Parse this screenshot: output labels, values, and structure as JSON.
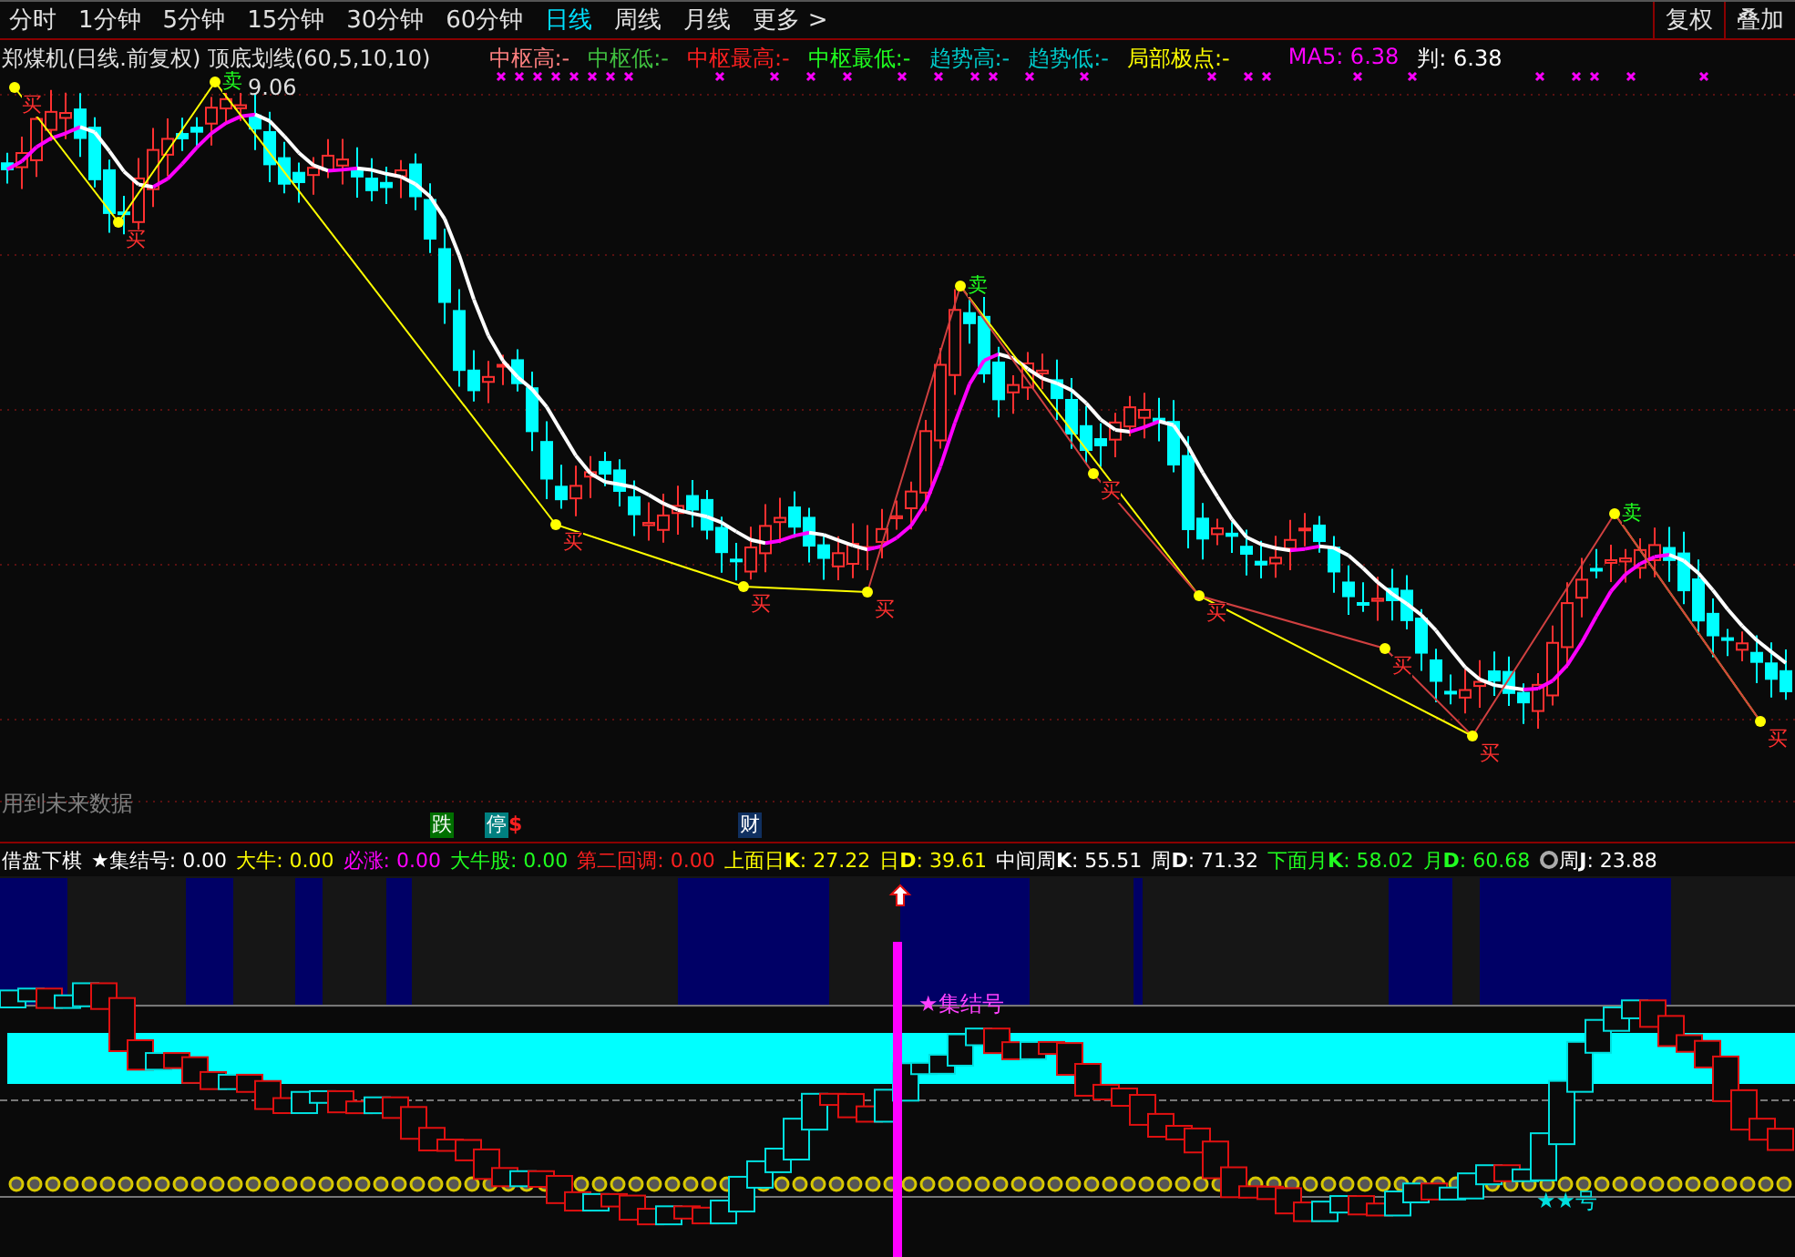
{
  "tabs": [
    {
      "label": "分时",
      "selected": false
    },
    {
      "label": "1分钟",
      "selected": false
    },
    {
      "label": "5分钟",
      "selected": false
    },
    {
      "label": "15分钟",
      "selected": false
    },
    {
      "label": "30分钟",
      "selected": false
    },
    {
      "label": "60分钟",
      "selected": false
    },
    {
      "label": "日线",
      "selected": true
    },
    {
      "label": "周线",
      "selected": false
    },
    {
      "label": "月线",
      "selected": false
    },
    {
      "label": "更多 >",
      "selected": false
    }
  ],
  "right_buttons": [
    "复权",
    "叠加"
  ],
  "main_chart": {
    "title": "郑煤机(日线.前复权) 顶底划线(60,5,10,10)",
    "legend": [
      {
        "label": "中枢高:-",
        "color": "#ff8080"
      },
      {
        "label": "中枢低:-",
        "color": "#40c040"
      },
      {
        "label": "中枢最高:-",
        "color": "#ff2020"
      },
      {
        "label": "中枢最低:-",
        "color": "#20ff20"
      },
      {
        "label": "趋势高:-",
        "color": "#00c8c8"
      },
      {
        "label": "趋势低:-",
        "color": "#00c8c8"
      },
      {
        "label": "局部极点:-",
        "color": "#ffff00"
      },
      {
        "label": "MA5: 6.38",
        "color": "#ff00ff"
      },
      {
        "label": "判: 6.38",
        "color": "#ffffff"
      }
    ],
    "high_price": "9.06",
    "signals": [
      {
        "text": "买",
        "kind": "low"
      },
      {
        "text": "买",
        "kind": "low"
      },
      {
        "text": "卖",
        "kind": "high"
      },
      {
        "text": "买",
        "kind": "low"
      },
      {
        "text": "买",
        "kind": "low"
      },
      {
        "text": "买",
        "kind": "low"
      },
      {
        "text": "卖",
        "kind": "high"
      },
      {
        "text": "买",
        "kind": "low"
      },
      {
        "text": "买",
        "kind": "low"
      },
      {
        "text": "买",
        "kind": "low"
      },
      {
        "text": "买",
        "kind": "low"
      },
      {
        "text": "卖",
        "kind": "high"
      },
      {
        "text": "买",
        "kind": "low"
      }
    ],
    "note": "用到未来数据",
    "badges": [
      {
        "text": "跌",
        "color": "#007000",
        "kind": "tag"
      },
      {
        "text": "停",
        "color": "#008080",
        "kind": "tag"
      },
      {
        "text": "$",
        "color": "#ff2020",
        "kind": "text"
      },
      {
        "text": "财",
        "color": "#103060",
        "kind": "tag"
      }
    ]
  },
  "indicator_bar": [
    {
      "text": "借盘下棋",
      "color": "#ffffff"
    },
    {
      "text": "★集结号: 0.00",
      "color": "#ffffff"
    },
    {
      "text": "大牛: 0.00",
      "color": "#ffff00"
    },
    {
      "text": "必涨: 0.00",
      "color": "#ff00ff"
    },
    {
      "text": "大牛股: 0.00",
      "color": "#20ff20"
    },
    {
      "text": "第二回调: 0.00",
      "color": "#ff2020"
    },
    {
      "text": "上面日**K**: 27.22",
      "color": "#ffff00"
    },
    {
      "text": "日**D**: 39.61",
      "color": "#ffff00"
    },
    {
      "text": "中间周**K**: 55.51",
      "color": "#ffffff"
    },
    {
      "text": "周**D**: 71.32",
      "color": "#ffffff"
    },
    {
      "text": "下面月**K**: 58.02",
      "color": "#20ff20"
    },
    {
      "text": "月**D**: 60.68",
      "color": "#20ff20"
    },
    {
      "text": "周**J**: 23.88",
      "color": "#ffffff",
      "icon": true
    }
  ],
  "lower_panel": {
    "labels": [
      {
        "text": "★集结号",
        "color": "#ff40ff"
      },
      {
        "text": "★★号",
        "color": "#00e0e0"
      }
    ]
  }
}
